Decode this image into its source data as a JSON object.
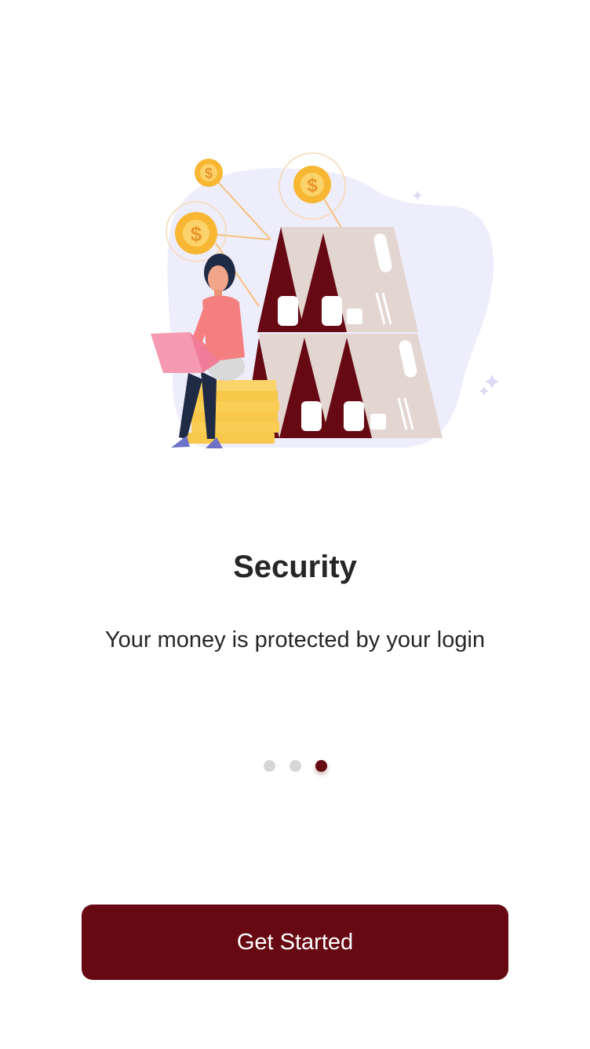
{
  "onboarding": {
    "title": "Security",
    "description": "Your money is protected by your login",
    "pager": {
      "total": 3,
      "active_index": 2
    },
    "cta_label": "Get Started",
    "coin_symbol": "$",
    "colors": {
      "primary": "#660912",
      "dot_inactive": "#d6d6d6",
      "text": "#262626",
      "blob": "#eeedfc",
      "card": "#e3d5cf",
      "coin": "#f7b733"
    },
    "illustration_icon": "woman-with-laptop-on-coins-and-card-house"
  }
}
